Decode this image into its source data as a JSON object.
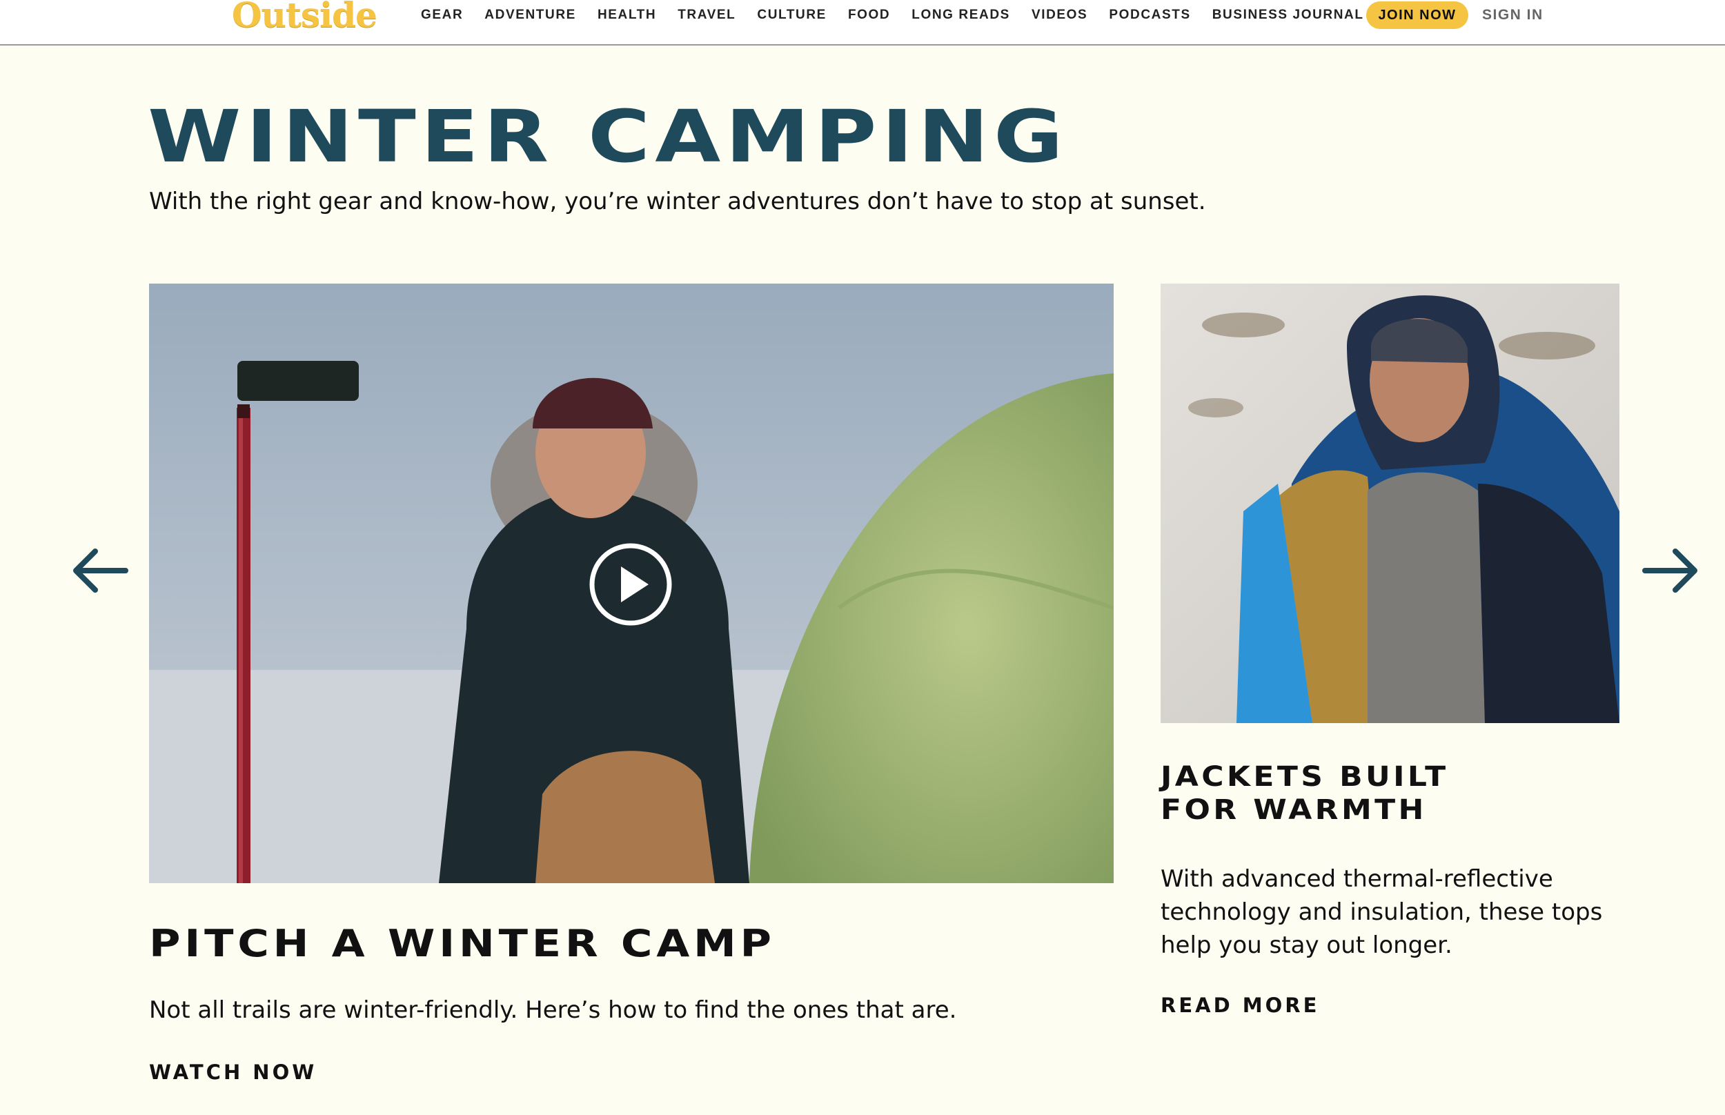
{
  "header": {
    "logo_text": "Outside",
    "nav": [
      "GEAR",
      "ADVENTURE",
      "HEALTH",
      "TRAVEL",
      "CULTURE",
      "FOOD",
      "LONG READS",
      "VIDEOS",
      "PODCASTS",
      "BUSINESS JOURNAL"
    ],
    "join_label": "JOIN NOW",
    "signin_label": "SIGN IN"
  },
  "section": {
    "title": "WINTER CAMPING",
    "subtitle": "With the right gear and know-how, you’re winter adventures don’t have to stop at sunset."
  },
  "carousel": {
    "prev_icon": "arrow-left-icon",
    "next_icon": "arrow-right-icon",
    "main_card": {
      "media_type": "video",
      "title": "PITCH A WINTER CAMP",
      "description": "Not all trails are winter-friendly. Here’s how to find the ones that are.",
      "cta": "WATCH NOW"
    },
    "side_card": {
      "title_lines": [
        "JACKETS BUILT",
        "FOR WARMTH"
      ],
      "description_lines": [
        "With advanced thermal-reflective",
        "technology and insulation, these tops",
        "help you stay out longer."
      ],
      "cta": "READ MORE"
    }
  },
  "colors": {
    "brand_yellow": "#F6C443",
    "title_teal": "#1F4A5C",
    "page_bg": "#FDFDF2"
  }
}
